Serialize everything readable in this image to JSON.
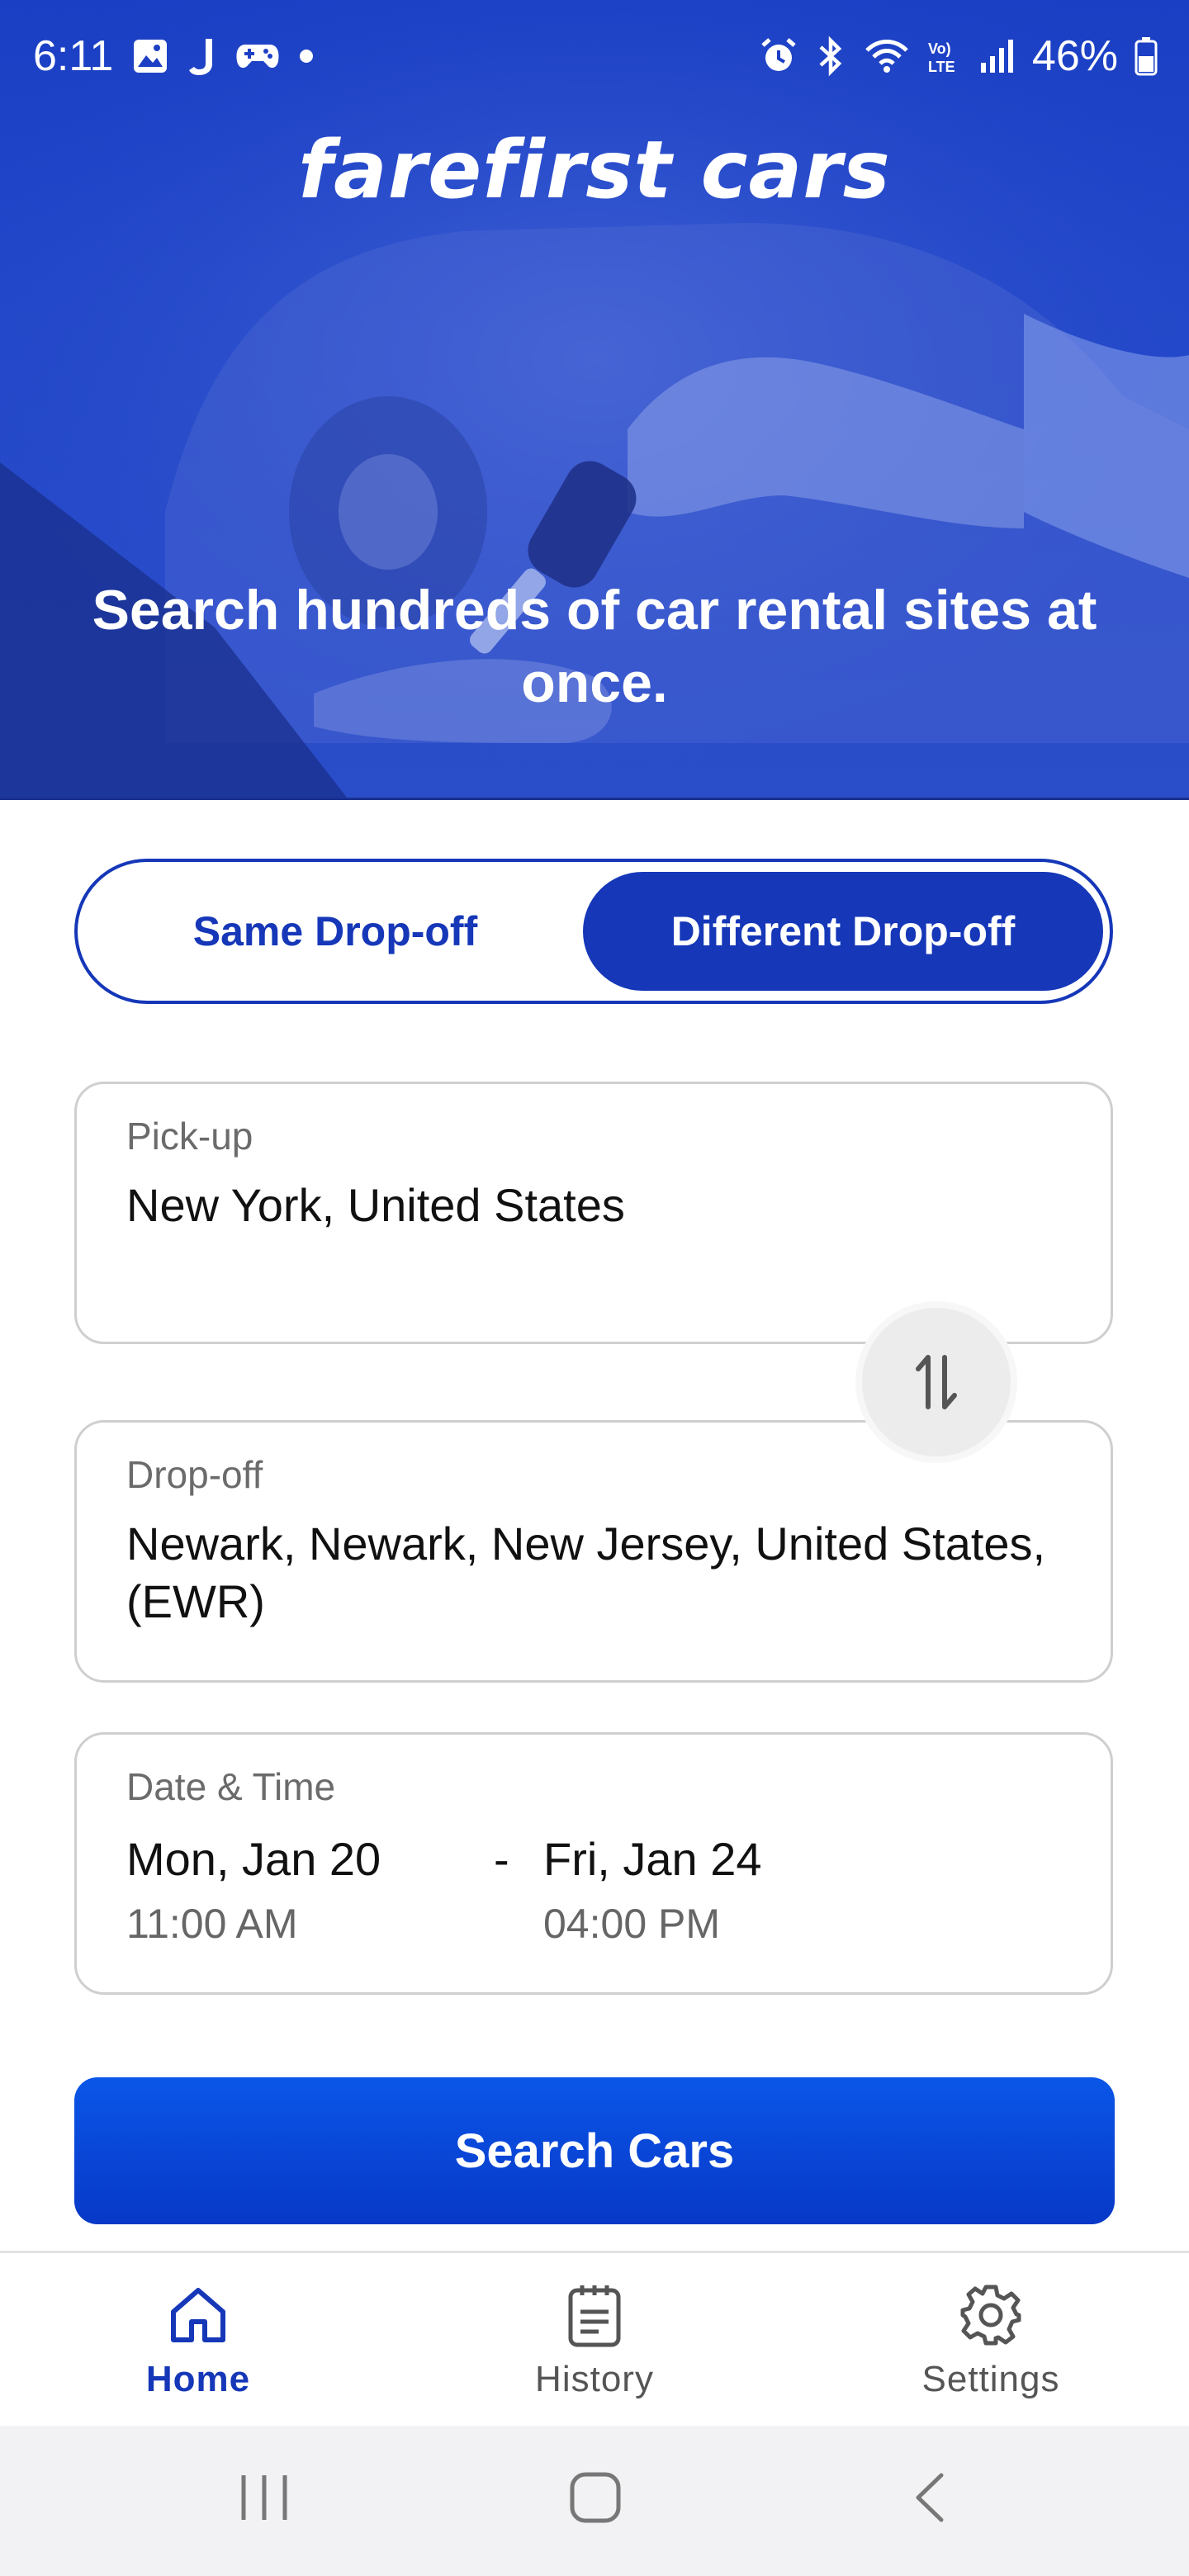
{
  "status_bar": {
    "time": "6:11",
    "battery": "46%",
    "icons_left": [
      "gallery-icon",
      "j-app-icon",
      "gamepad-icon",
      "dot-icon"
    ],
    "icons_right": [
      "alarm-icon",
      "bluetooth-icon",
      "wifi-icon",
      "volte-icon",
      "signal-icon",
      "battery-icon"
    ]
  },
  "hero": {
    "brand": "farefirst cars",
    "tagline": "Search hundreds of car rental sites at once."
  },
  "toggle": {
    "same_label": "Same Drop-off",
    "different_label": "Different Drop-off",
    "selected": "Different Drop-off"
  },
  "pickup": {
    "label": "Pick-up",
    "value": "New York, United States"
  },
  "dropoff": {
    "label": "Drop-off",
    "value": "Newark, Newark, New Jersey, United States, (EWR)"
  },
  "datetime": {
    "label": "Date & Time",
    "start_date": "Mon, Jan 20",
    "start_time": "11:00 AM",
    "separator": "-",
    "end_date": "Fri, Jan 24",
    "end_time": "04:00 PM"
  },
  "search_button": "Search Cars",
  "bottom_nav": {
    "items": [
      {
        "label": "Home",
        "icon": "home-icon",
        "active": true
      },
      {
        "label": "History",
        "icon": "notepad-icon",
        "active": false
      },
      {
        "label": "Settings",
        "icon": "gear-icon",
        "active": false
      }
    ]
  },
  "system_nav": [
    "recents-icon",
    "home-circle-icon",
    "back-icon"
  ],
  "colors": {
    "primary": "#1537b8",
    "button": "#0a56e8",
    "hero": "#2146c8"
  }
}
